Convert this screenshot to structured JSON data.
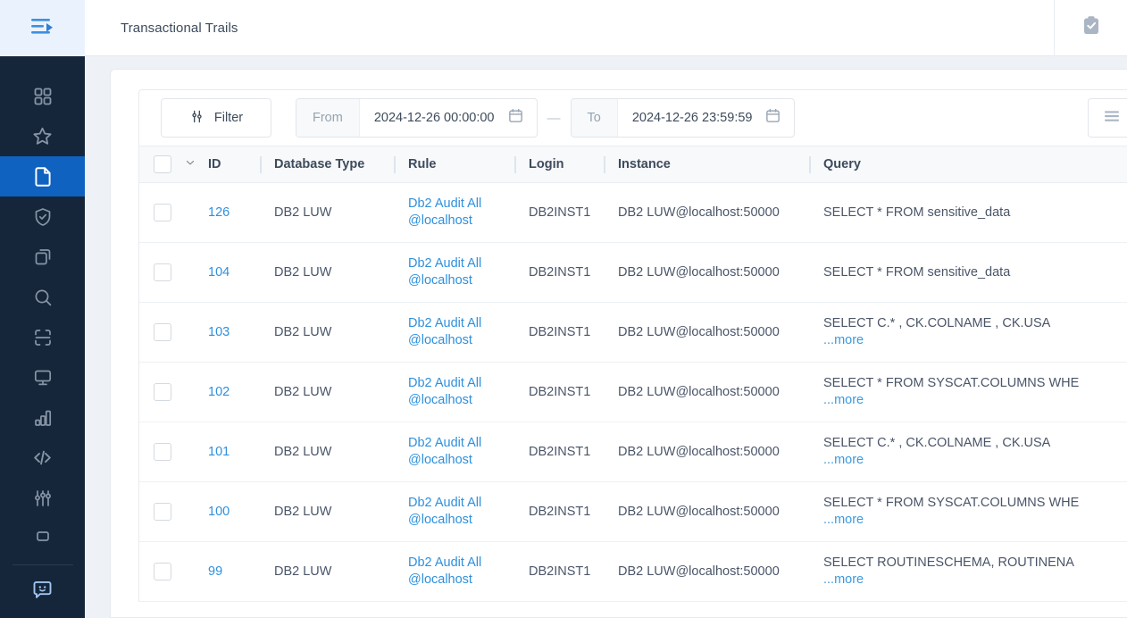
{
  "app": {
    "title": "Transactional Trails",
    "accent": "#0f62c0",
    "link_color": "#2e90dd",
    "sidebar_bg": "#16263a"
  },
  "sidebar": {
    "toggle": {
      "icon": "menu-expand-icon"
    },
    "items": [
      {
        "name": "dashboard",
        "icon": "grid-icon",
        "active": false
      },
      {
        "name": "favorites",
        "icon": "star-icon",
        "active": false
      },
      {
        "name": "reports",
        "icon": "document-icon",
        "active": true
      },
      {
        "name": "security",
        "icon": "shield-check-icon",
        "active": false
      },
      {
        "name": "copies",
        "icon": "layers-icon",
        "active": false
      },
      {
        "name": "discovery",
        "icon": "search-icon",
        "active": false
      },
      {
        "name": "scan",
        "icon": "scan-frame-icon",
        "active": false
      },
      {
        "name": "monitors",
        "icon": "monitor-icon",
        "active": false
      },
      {
        "name": "analytics",
        "icon": "bar-chart-icon",
        "active": false
      },
      {
        "name": "api",
        "icon": "code-icon",
        "active": false
      },
      {
        "name": "settings",
        "icon": "sliders-icon",
        "active": false
      }
    ],
    "bottom": {
      "name": "support-chat",
      "icon": "chat-smiley-icon"
    }
  },
  "topbar": {
    "title": "Transactional Trails",
    "clipboard_icon": "clipboard-check-icon"
  },
  "toolbar": {
    "filter_label": "Filter",
    "filter_icon": "sliders-icon",
    "from_label": "From",
    "from_value": "2024-12-26 00:00:00",
    "to_label": "To",
    "to_value": "2024-12-26 23:59:59",
    "separator": "—",
    "calendar_icon": "calendar-icon",
    "list_icon": "list-menu-icon"
  },
  "table": {
    "columns": [
      {
        "key": "checkbox",
        "label": ""
      },
      {
        "key": "id",
        "label": "ID"
      },
      {
        "key": "db_type",
        "label": "Database Type"
      },
      {
        "key": "rule",
        "label": "Rule"
      },
      {
        "key": "login",
        "label": "Login"
      },
      {
        "key": "instance",
        "label": "Instance"
      },
      {
        "key": "query",
        "label": "Query"
      }
    ],
    "more_label": "...more",
    "rows": [
      {
        "id": "126",
        "db_type": "DB2 LUW",
        "rule": "Db2 Audit All @localhost",
        "login": "DB2INST1",
        "instance": "DB2 LUW@localhost:50000",
        "query": "SELECT * FROM sensitive_data",
        "truncated": false
      },
      {
        "id": "104",
        "db_type": "DB2 LUW",
        "rule": "Db2 Audit All @localhost",
        "login": "DB2INST1",
        "instance": "DB2 LUW@localhost:50000",
        "query": "SELECT * FROM sensitive_data",
        "truncated": false
      },
      {
        "id": "103",
        "db_type": "DB2 LUW",
        "rule": "Db2 Audit All @localhost",
        "login": "DB2INST1",
        "instance": "DB2 LUW@localhost:50000",
        "query": "SELECT C.*     , CK.COLNAME     , CK.USA",
        "truncated": true
      },
      {
        "id": "102",
        "db_type": "DB2 LUW",
        "rule": "Db2 Audit All @localhost",
        "login": "DB2INST1",
        "instance": "DB2 LUW@localhost:50000",
        "query": "SELECT * FROM SYSCAT.COLUMNS WHE",
        "truncated": true
      },
      {
        "id": "101",
        "db_type": "DB2 LUW",
        "rule": "Db2 Audit All @localhost",
        "login": "DB2INST1",
        "instance": "DB2 LUW@localhost:50000",
        "query": "SELECT C.*     , CK.COLNAME     , CK.USA",
        "truncated": true
      },
      {
        "id": "100",
        "db_type": "DB2 LUW",
        "rule": "Db2 Audit All @localhost",
        "login": "DB2INST1",
        "instance": "DB2 LUW@localhost:50000",
        "query": "SELECT * FROM SYSCAT.COLUMNS WHE",
        "truncated": true
      },
      {
        "id": "99",
        "db_type": "DB2 LUW",
        "rule": "Db2 Audit All @localhost",
        "login": "DB2INST1",
        "instance": "DB2 LUW@localhost:50000",
        "query": "SELECT ROUTINESCHEMA, ROUTINENA",
        "truncated": true
      }
    ]
  }
}
